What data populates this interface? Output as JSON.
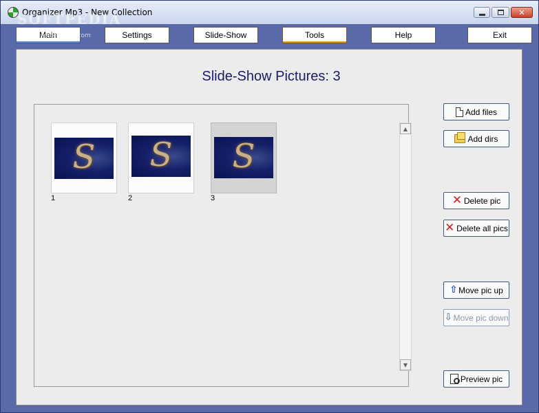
{
  "window": {
    "title": "Organizer Mp3 - New Collection",
    "watermark": "SOFTPEDIA",
    "watermark_sub": "www.softpedia.com",
    "caption_close": "✕"
  },
  "toolbar": {
    "main": "Main",
    "settings": "Settings",
    "slideshow": "Slide-Show",
    "tools": "Tools",
    "help": "Help",
    "exit": "Exit"
  },
  "panel": {
    "heading": "Slide-Show Pictures: 3"
  },
  "gallery": {
    "thumbnails": [
      {
        "label": "1",
        "glyph": "S",
        "selected": false
      },
      {
        "label": "2",
        "glyph": "S",
        "selected": false
      },
      {
        "label": "3",
        "glyph": "S",
        "selected": true
      }
    ],
    "scroll_up": "▲",
    "scroll_down": "▼"
  },
  "actions": {
    "add_files": "Add files",
    "add_dirs": "Add dirs",
    "delete_pic": "Delete pic",
    "delete_all": "Delete all pics",
    "move_up": "Move pic up",
    "move_down": "Move pic down",
    "preview": "Preview pic"
  },
  "icons": {
    "delete": "✕",
    "up": "⇧",
    "down": "⇩"
  }
}
